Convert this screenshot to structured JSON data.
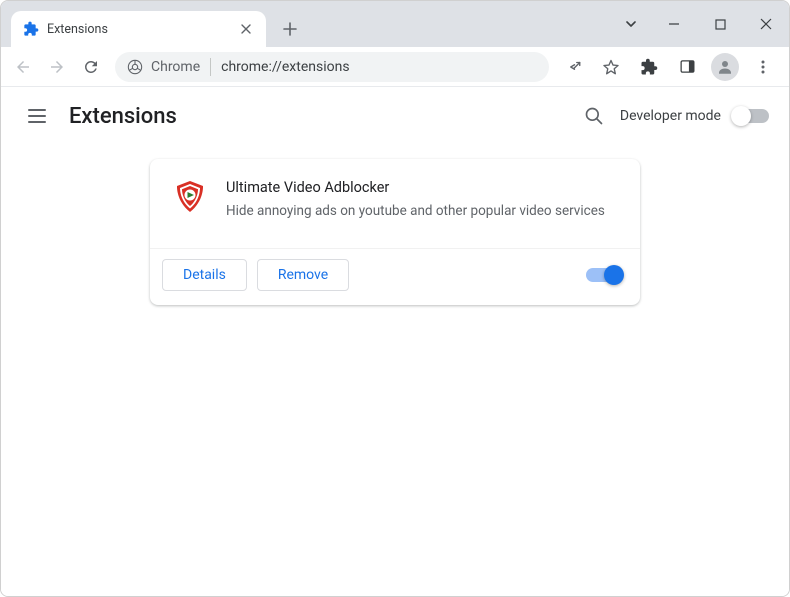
{
  "tab": {
    "title": "Extensions"
  },
  "addressbar": {
    "scheme_label": "Chrome",
    "url": "chrome://extensions"
  },
  "header": {
    "title": "Extensions",
    "developer_mode_label": "Developer mode"
  },
  "extension": {
    "name": "Ultimate Video Adblocker",
    "description": "Hide annoying ads on youtube and other popular video services",
    "details_label": "Details",
    "remove_label": "Remove",
    "enabled": true
  }
}
